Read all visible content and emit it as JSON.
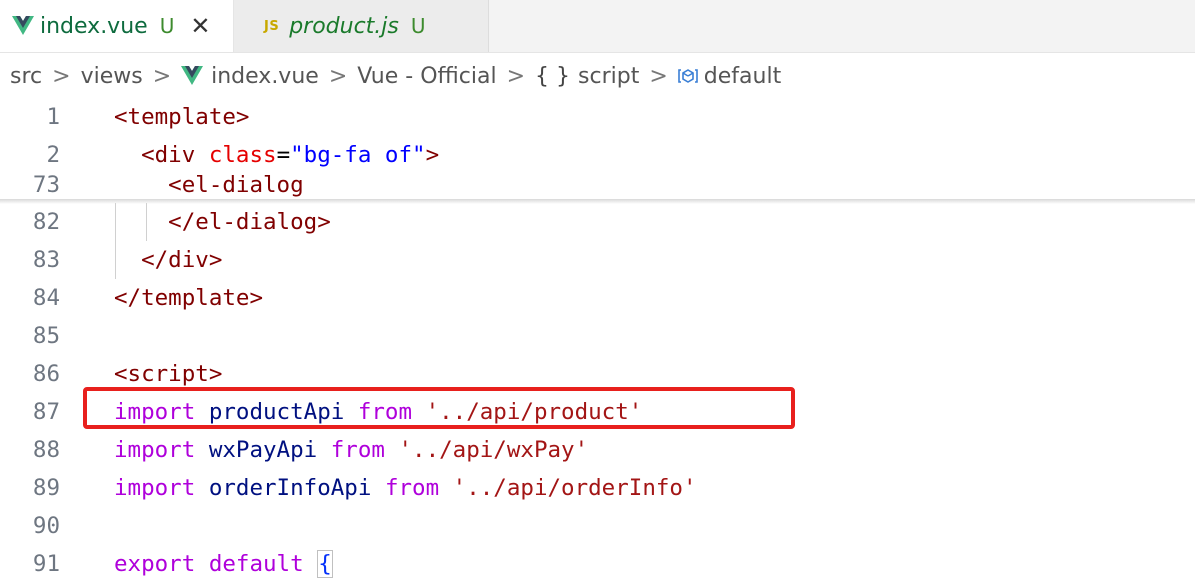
{
  "tabs": [
    {
      "label": "index.vue",
      "status": "U",
      "icon": "vue-icon",
      "active": true
    },
    {
      "label": "product.js",
      "status": "U",
      "icon": "js-icon",
      "icon_text": "JS",
      "active": false
    }
  ],
  "close_glyph": "✕",
  "breadcrumb": {
    "items": [
      "src",
      "views",
      "index.vue",
      "Vue - Official",
      "script",
      "default"
    ],
    "separator": ">",
    "script_icon_text": "{ }"
  },
  "code_lines": [
    {
      "num": "1",
      "tokens": [
        {
          "t": "<template>",
          "c": "tag"
        }
      ]
    },
    {
      "num": "2",
      "tokens": [
        {
          "t": "  <div ",
          "c": "tag"
        },
        {
          "t": "class",
          "c": "attr"
        },
        {
          "t": "=",
          "c": "plain"
        },
        {
          "t": "\"bg-fa of\"",
          "c": "str-blue"
        },
        {
          "t": ">",
          "c": "tag"
        }
      ]
    },
    {
      "num": "73",
      "tokens": [
        {
          "t": "    <el-dialog",
          "c": "tag"
        }
      ]
    },
    {
      "num": "82",
      "tokens": [
        {
          "t": "    </el-dialog>",
          "c": "tag"
        }
      ]
    },
    {
      "num": "83",
      "tokens": [
        {
          "t": "  </div>",
          "c": "tag"
        }
      ]
    },
    {
      "num": "84",
      "tokens": [
        {
          "t": "</template>",
          "c": "tag"
        }
      ]
    },
    {
      "num": "85",
      "tokens": []
    },
    {
      "num": "86",
      "tokens": [
        {
          "t": "<script>",
          "c": "tag"
        }
      ]
    },
    {
      "num": "87",
      "tokens": [
        {
          "t": "import",
          "c": "kw"
        },
        {
          "t": " ",
          "c": "plain"
        },
        {
          "t": "productApi",
          "c": "id"
        },
        {
          "t": " ",
          "c": "plain"
        },
        {
          "t": "from",
          "c": "kw"
        },
        {
          "t": " ",
          "c": "plain"
        },
        {
          "t": "'../api/product'",
          "c": "str"
        }
      ]
    },
    {
      "num": "88",
      "tokens": [
        {
          "t": "import",
          "c": "kw"
        },
        {
          "t": " ",
          "c": "plain"
        },
        {
          "t": "wxPayApi",
          "c": "id"
        },
        {
          "t": " ",
          "c": "plain"
        },
        {
          "t": "from",
          "c": "kw"
        },
        {
          "t": " ",
          "c": "plain"
        },
        {
          "t": "'../api/wxPay'",
          "c": "str"
        }
      ]
    },
    {
      "num": "89",
      "tokens": [
        {
          "t": "import",
          "c": "kw"
        },
        {
          "t": " ",
          "c": "plain"
        },
        {
          "t": "orderInfoApi",
          "c": "id"
        },
        {
          "t": " ",
          "c": "plain"
        },
        {
          "t": "from",
          "c": "kw"
        },
        {
          "t": " ",
          "c": "plain"
        },
        {
          "t": "'../api/orderInfo'",
          "c": "str"
        }
      ]
    },
    {
      "num": "90",
      "tokens": []
    },
    {
      "num": "91",
      "tokens": [
        {
          "t": "export",
          "c": "kw"
        },
        {
          "t": " ",
          "c": "plain"
        },
        {
          "t": "default",
          "c": "kw"
        },
        {
          "t": " ",
          "c": "plain"
        },
        {
          "t": "{",
          "c": "brace"
        }
      ]
    }
  ],
  "colors": {
    "tag": "#800000",
    "attr": "#e50000",
    "keyword": "#af00db",
    "identifier": "#001080",
    "string": "#a31515",
    "highlight_box": "#e8201d"
  }
}
